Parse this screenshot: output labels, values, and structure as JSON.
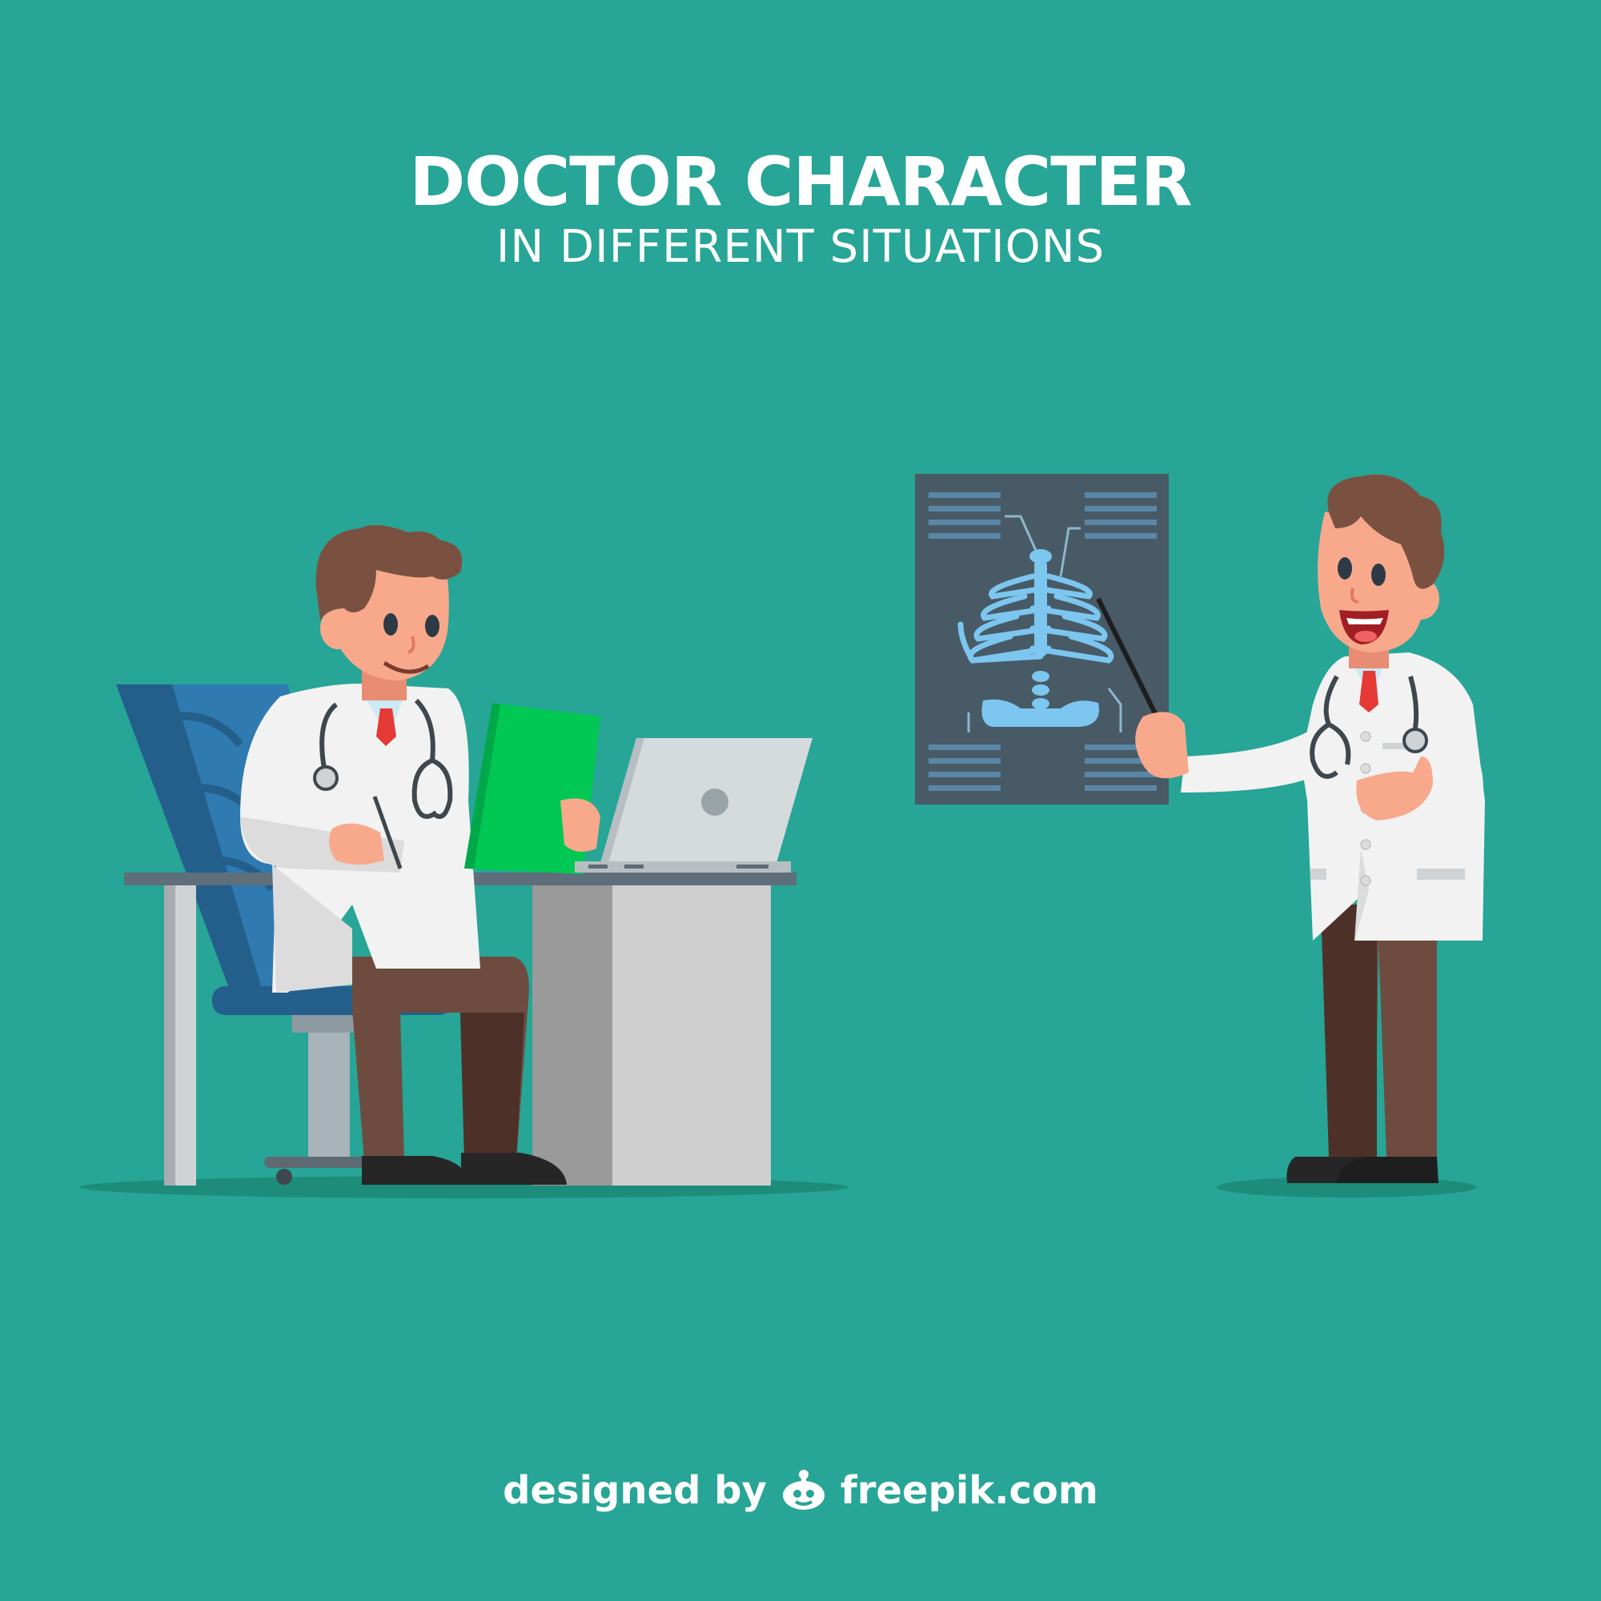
{
  "title": "DOCTOR CHARACTER",
  "subtitle": "IN DIFFERENT SITUATIONS",
  "credit": {
    "designed_by": "designed by",
    "brand": "freepik.com"
  },
  "colors": {
    "background": "#27a596",
    "coat": "#f2f2f2",
    "hair": "#7a5140",
    "skin": "#f8a98c",
    "trousers": "#6d4b3f",
    "chair": "#2f7ab0",
    "xray_panel": "#475a66",
    "xray_bones": "#7cc6ef",
    "clipboard": "#00c853",
    "laptop": "#d5dadd"
  },
  "icons": [
    "freepik-logo-icon"
  ]
}
